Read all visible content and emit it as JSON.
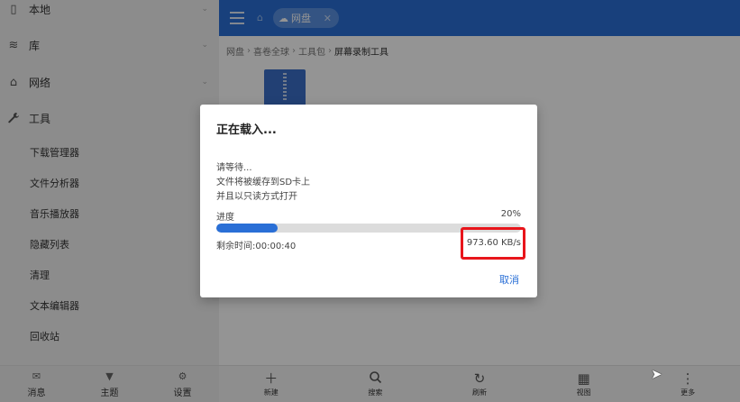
{
  "sidebar": {
    "sections": [
      {
        "label": "本地",
        "icon": "phone-icon"
      },
      {
        "label": "库",
        "icon": "stack-icon"
      },
      {
        "label": "网络",
        "icon": "network-icon"
      },
      {
        "label": "工具",
        "icon": "wrench-icon"
      }
    ],
    "tools": [
      "下载管理器",
      "文件分析器",
      "音乐播放器",
      "隐藏列表",
      "清理",
      "文本编辑器",
      "回收站"
    ],
    "bottom_nav": [
      {
        "label": "消息",
        "icon": "mail-icon"
      },
      {
        "label": "主题",
        "icon": "shirt-icon"
      },
      {
        "label": "设置",
        "icon": "gear-icon"
      }
    ]
  },
  "topbar": {
    "tab_label": "网盘"
  },
  "breadcrumb": [
    "网盘",
    "喜卷全球",
    "工具包",
    "屏幕录制工具"
  ],
  "toolbar": [
    {
      "label": "新建",
      "icon": "plus-icon"
    },
    {
      "label": "搜索",
      "icon": "search-icon"
    },
    {
      "label": "刷新",
      "icon": "refresh-icon"
    },
    {
      "label": "视图",
      "icon": "grid-icon"
    },
    {
      "label": "更多",
      "icon": "more-icon"
    }
  ],
  "dialog": {
    "title": "正在载入...",
    "message_lines": [
      "请等待...",
      "文件将被缓存到SD卡上",
      "并且以只读方式打开"
    ],
    "progress_label": "进度",
    "progress_percent_text": "20%",
    "progress_value": 0.2,
    "remaining": "剩余时间:00:00:40",
    "speed": "973.60 KB/s",
    "cancel_label": "取消"
  },
  "colors": {
    "accent": "#2a6fd6",
    "highlight": "#e8151b"
  }
}
